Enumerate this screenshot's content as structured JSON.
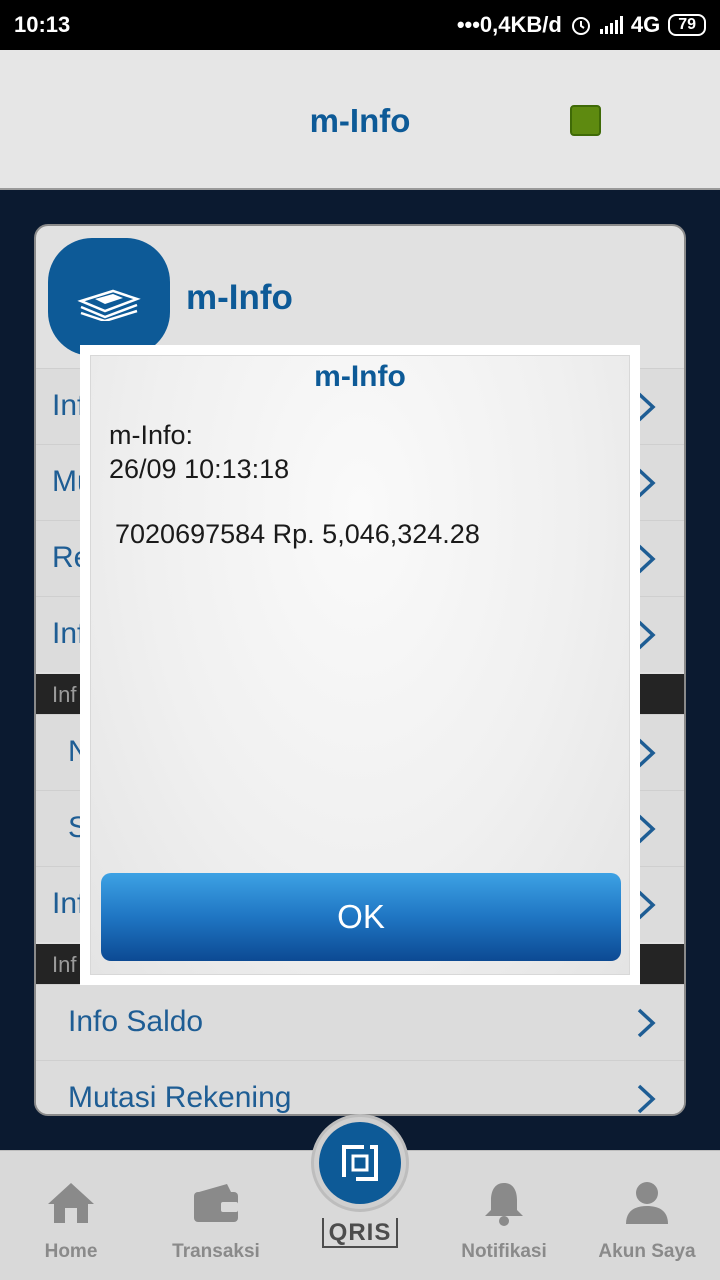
{
  "status_bar": {
    "time": "10:13",
    "network_speed": "•••0,4KB/d",
    "network_type": "4G",
    "battery": "79"
  },
  "header": {
    "title": "m-Info"
  },
  "card": {
    "title": "m-Info",
    "rows": [
      "Inf",
      "Mu",
      "Re",
      "Inf"
    ],
    "section1": "Inf",
    "sub_rows": [
      "N",
      "S"
    ],
    "row_after": "Inf",
    "section2": "Inf",
    "info_saldo": "Info Saldo",
    "mutasi_rekening": "Mutasi Rekening"
  },
  "dialog": {
    "title": "m-Info",
    "line1": "m-Info:",
    "line2": "26/09 10:13:18",
    "line3": "7020697584 Rp. 5,046,324.28",
    "ok_label": "OK"
  },
  "bottom_nav": {
    "home": "Home",
    "transaksi": "Transaksi",
    "qris": "QRIS",
    "notifikasi": "Notifikasi",
    "akun": "Akun Saya"
  }
}
